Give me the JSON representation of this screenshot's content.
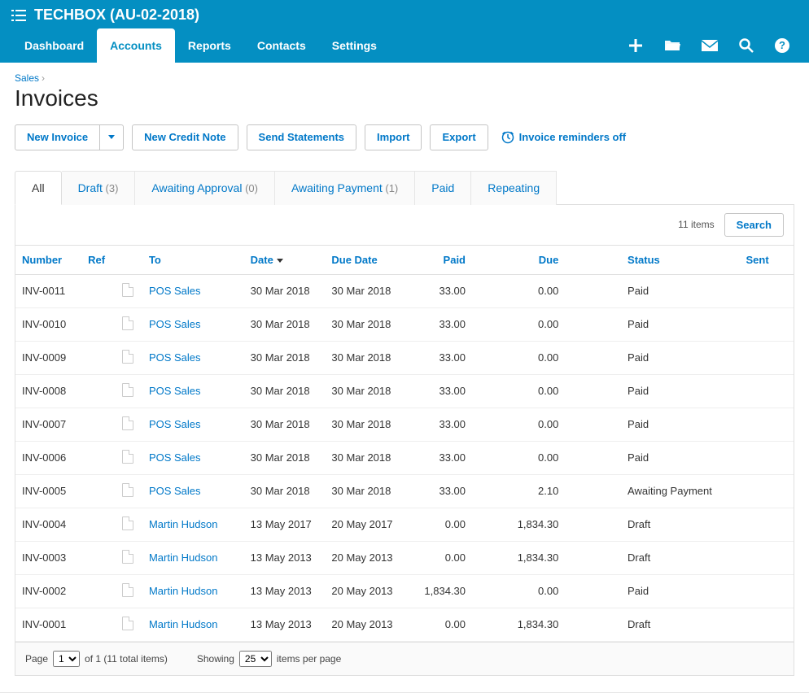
{
  "header": {
    "org_name": "TECHBOX (AU-02-2018)",
    "nav": [
      "Dashboard",
      "Accounts",
      "Reports",
      "Contacts",
      "Settings"
    ],
    "active_nav": "Accounts"
  },
  "breadcrumb": {
    "parent": "Sales",
    "sep": "›"
  },
  "page_title": "Invoices",
  "actions": {
    "new_invoice": "New Invoice",
    "new_credit_note": "New Credit Note",
    "send_statements": "Send Statements",
    "import": "Import",
    "export": "Export",
    "reminders": "Invoice reminders off"
  },
  "filter_tabs": [
    {
      "label": "All",
      "count": null,
      "active": true
    },
    {
      "label": "Draft",
      "count": "(3)",
      "active": false
    },
    {
      "label": "Awaiting Approval",
      "count": "(0)",
      "active": false
    },
    {
      "label": "Awaiting Payment",
      "count": "(1)",
      "active": false
    },
    {
      "label": "Paid",
      "count": null,
      "active": false
    },
    {
      "label": "Repeating",
      "count": null,
      "active": false
    }
  ],
  "table": {
    "item_count_label": "11 items",
    "search_label": "Search",
    "headers": {
      "number": "Number",
      "ref": "Ref",
      "to": "To",
      "date": "Date",
      "due_date": "Due Date",
      "paid": "Paid",
      "due": "Due",
      "status": "Status",
      "sent": "Sent"
    },
    "rows": [
      {
        "number": "INV-0011",
        "to": "POS Sales",
        "date": "30 Mar 2018",
        "due_date": "30 Mar 2018",
        "paid": "33.00",
        "due": "0.00",
        "status": "Paid"
      },
      {
        "number": "INV-0010",
        "to": "POS Sales",
        "date": "30 Mar 2018",
        "due_date": "30 Mar 2018",
        "paid": "33.00",
        "due": "0.00",
        "status": "Paid"
      },
      {
        "number": "INV-0009",
        "to": "POS Sales",
        "date": "30 Mar 2018",
        "due_date": "30 Mar 2018",
        "paid": "33.00",
        "due": "0.00",
        "status": "Paid"
      },
      {
        "number": "INV-0008",
        "to": "POS Sales",
        "date": "30 Mar 2018",
        "due_date": "30 Mar 2018",
        "paid": "33.00",
        "due": "0.00",
        "status": "Paid"
      },
      {
        "number": "INV-0007",
        "to": "POS Sales",
        "date": "30 Mar 2018",
        "due_date": "30 Mar 2018",
        "paid": "33.00",
        "due": "0.00",
        "status": "Paid"
      },
      {
        "number": "INV-0006",
        "to": "POS Sales",
        "date": "30 Mar 2018",
        "due_date": "30 Mar 2018",
        "paid": "33.00",
        "due": "0.00",
        "status": "Paid"
      },
      {
        "number": "INV-0005",
        "to": "POS Sales",
        "date": "30 Mar 2018",
        "due_date": "30 Mar 2018",
        "paid": "33.00",
        "due": "2.10",
        "status": "Awaiting Payment"
      },
      {
        "number": "INV-0004",
        "to": "Martin Hudson",
        "date": "13 May 2017",
        "due_date": "20 May 2017",
        "paid": "0.00",
        "due": "1,834.30",
        "status": "Draft"
      },
      {
        "number": "INV-0003",
        "to": "Martin Hudson",
        "date": "13 May 2013",
        "due_date": "20 May 2013",
        "paid": "0.00",
        "due": "1,834.30",
        "status": "Draft"
      },
      {
        "number": "INV-0002",
        "to": "Martin Hudson",
        "date": "13 May 2013",
        "due_date": "20 May 2013",
        "paid": "1,834.30",
        "due": "0.00",
        "status": "Paid"
      },
      {
        "number": "INV-0001",
        "to": "Martin Hudson",
        "date": "13 May 2013",
        "due_date": "20 May 2013",
        "paid": "0.00",
        "due": "1,834.30",
        "status": "Draft"
      }
    ]
  },
  "pager": {
    "page_label": "Page",
    "page_value": "1",
    "of_text": "of 1 (11 total items)",
    "showing_label": "Showing",
    "per_page_value": "25",
    "per_page_suffix": "items per page"
  }
}
